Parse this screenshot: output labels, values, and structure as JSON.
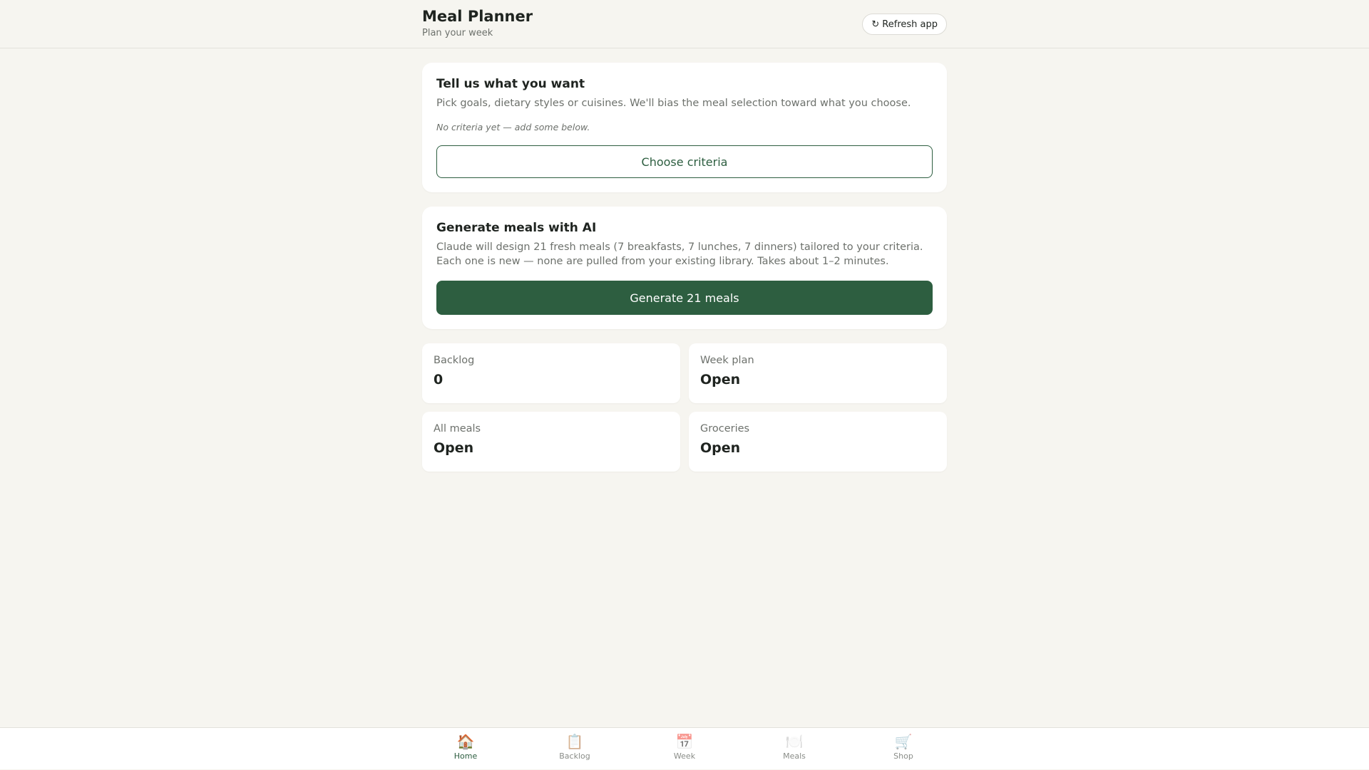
{
  "header": {
    "title": "Meal Planner",
    "subtitle": "Plan your week",
    "refresh_icon": "↻",
    "refresh_label": "Refresh app"
  },
  "criteria_card": {
    "title": "Tell us what you want",
    "description": "Pick goals, dietary styles or cuisines. We'll bias the meal selection toward what you choose.",
    "empty_note": "No criteria yet — add some below.",
    "button_label": "Choose criteria"
  },
  "generate_card": {
    "title": "Generate meals with AI",
    "description": "Claude will design 21 fresh meals (7 breakfasts, 7 lunches, 7 dinners) tailored to your criteria. Each one is new — none are pulled from your existing library. Takes about 1–2 minutes.",
    "button_label": "Generate 21 meals"
  },
  "tiles": [
    {
      "label": "Backlog",
      "value": "0"
    },
    {
      "label": "Week plan",
      "value": "Open"
    },
    {
      "label": "All meals",
      "value": "Open"
    },
    {
      "label": "Groceries",
      "value": "Open"
    }
  ],
  "bottom_nav": [
    {
      "icon": "🏠",
      "icon_name": "home-icon",
      "label": "Home",
      "active": true
    },
    {
      "icon": "📋",
      "icon_name": "clipboard-icon",
      "label": "Backlog",
      "active": false
    },
    {
      "icon": "📅",
      "icon_name": "calendar-icon",
      "label": "Week",
      "active": false
    },
    {
      "icon": "🍽️",
      "icon_name": "plate-icon",
      "label": "Meals",
      "active": false
    },
    {
      "icon": "🛒",
      "icon_name": "cart-icon",
      "label": "Shop",
      "active": false
    }
  ],
  "colors": {
    "accent": "#2d5e40",
    "background": "#f6f5f0",
    "muted_text": "#6d716c"
  }
}
